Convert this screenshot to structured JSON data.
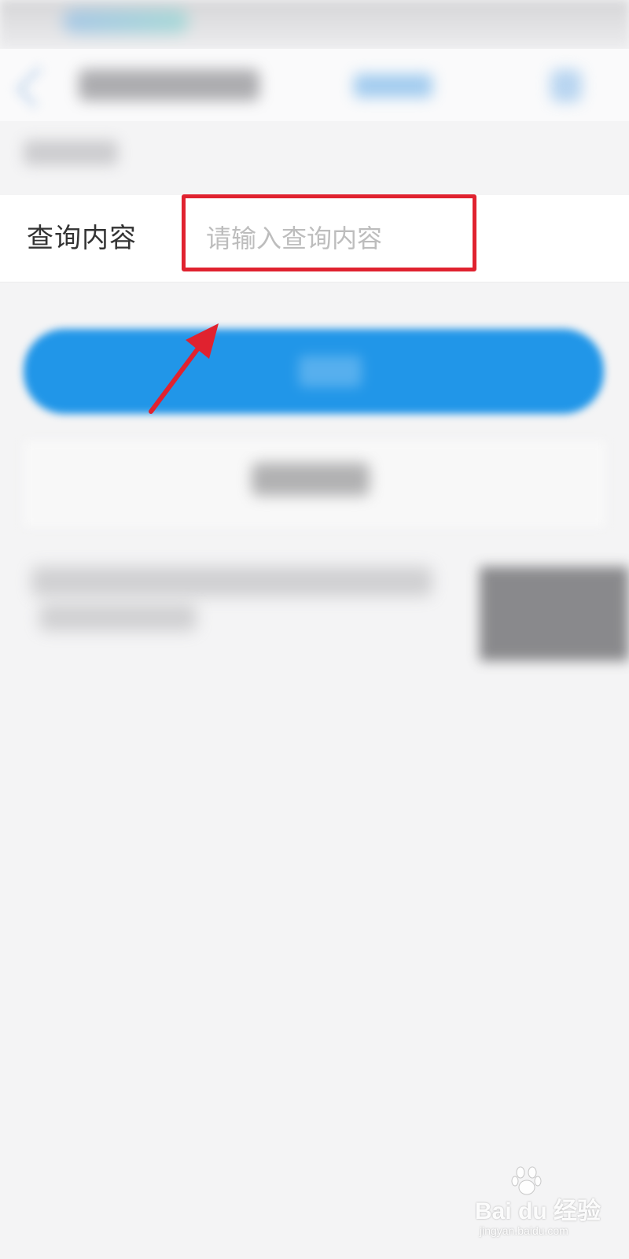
{
  "query_row": {
    "label": "查询内容",
    "input_value": "",
    "input_placeholder": "请输入查询内容"
  },
  "annotation": {
    "box_color": "#e0222f",
    "arrow_color": "#e0222f"
  },
  "colors": {
    "primary_button": "#2196e8",
    "page_background": "#f4f4f5"
  },
  "watermark": {
    "brand": "Bai du 经验",
    "site": "jingyan.baidu.com"
  }
}
